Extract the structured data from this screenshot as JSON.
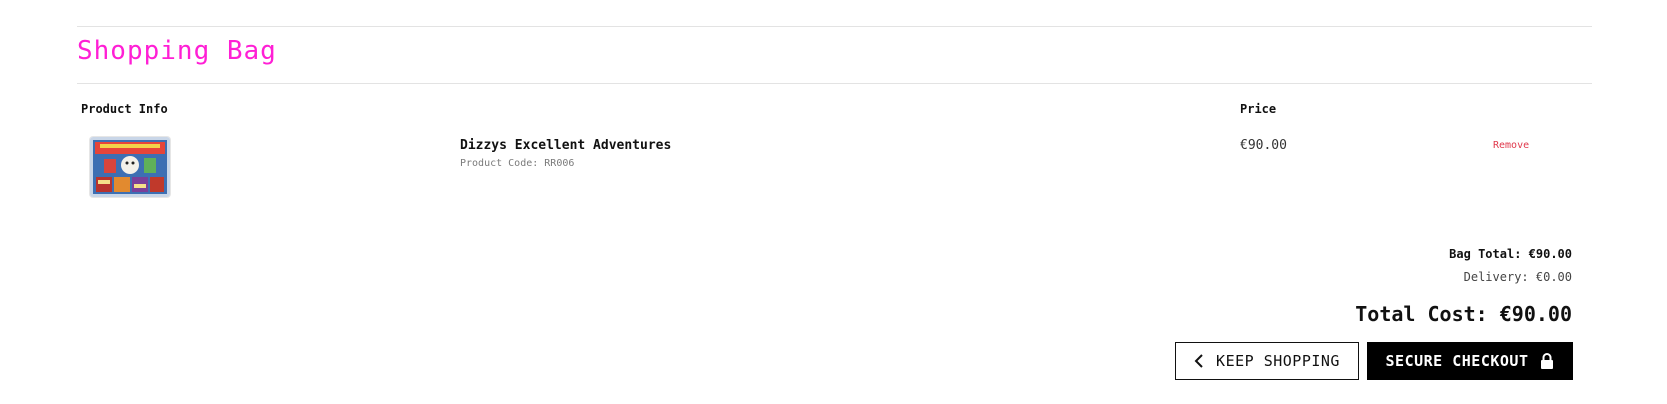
{
  "page": {
    "title": "Shopping Bag"
  },
  "table": {
    "headers": {
      "product_info": "Product Info",
      "price": "Price"
    },
    "items": [
      {
        "name": "Dizzys Excellent Adventures",
        "code": "Product Code: RR006",
        "price": "€90.00",
        "remove_label": "Remove",
        "thumbnail_icon": "product-image"
      }
    ]
  },
  "summary": {
    "bag_total": "Bag Total: €90.00",
    "delivery": "Delivery: €0.00",
    "total_cost": "Total Cost: €90.00"
  },
  "actions": {
    "keep_shopping": "KEEP SHOPPING",
    "keep_shopping_icon": "chevron-left-icon",
    "secure_checkout": "SECURE CHECKOUT",
    "secure_checkout_icon": "lock-icon"
  },
  "colors": {
    "accent": "#ff1fd5",
    "remove": "#e0384b",
    "checkout_bg": "#000000"
  }
}
